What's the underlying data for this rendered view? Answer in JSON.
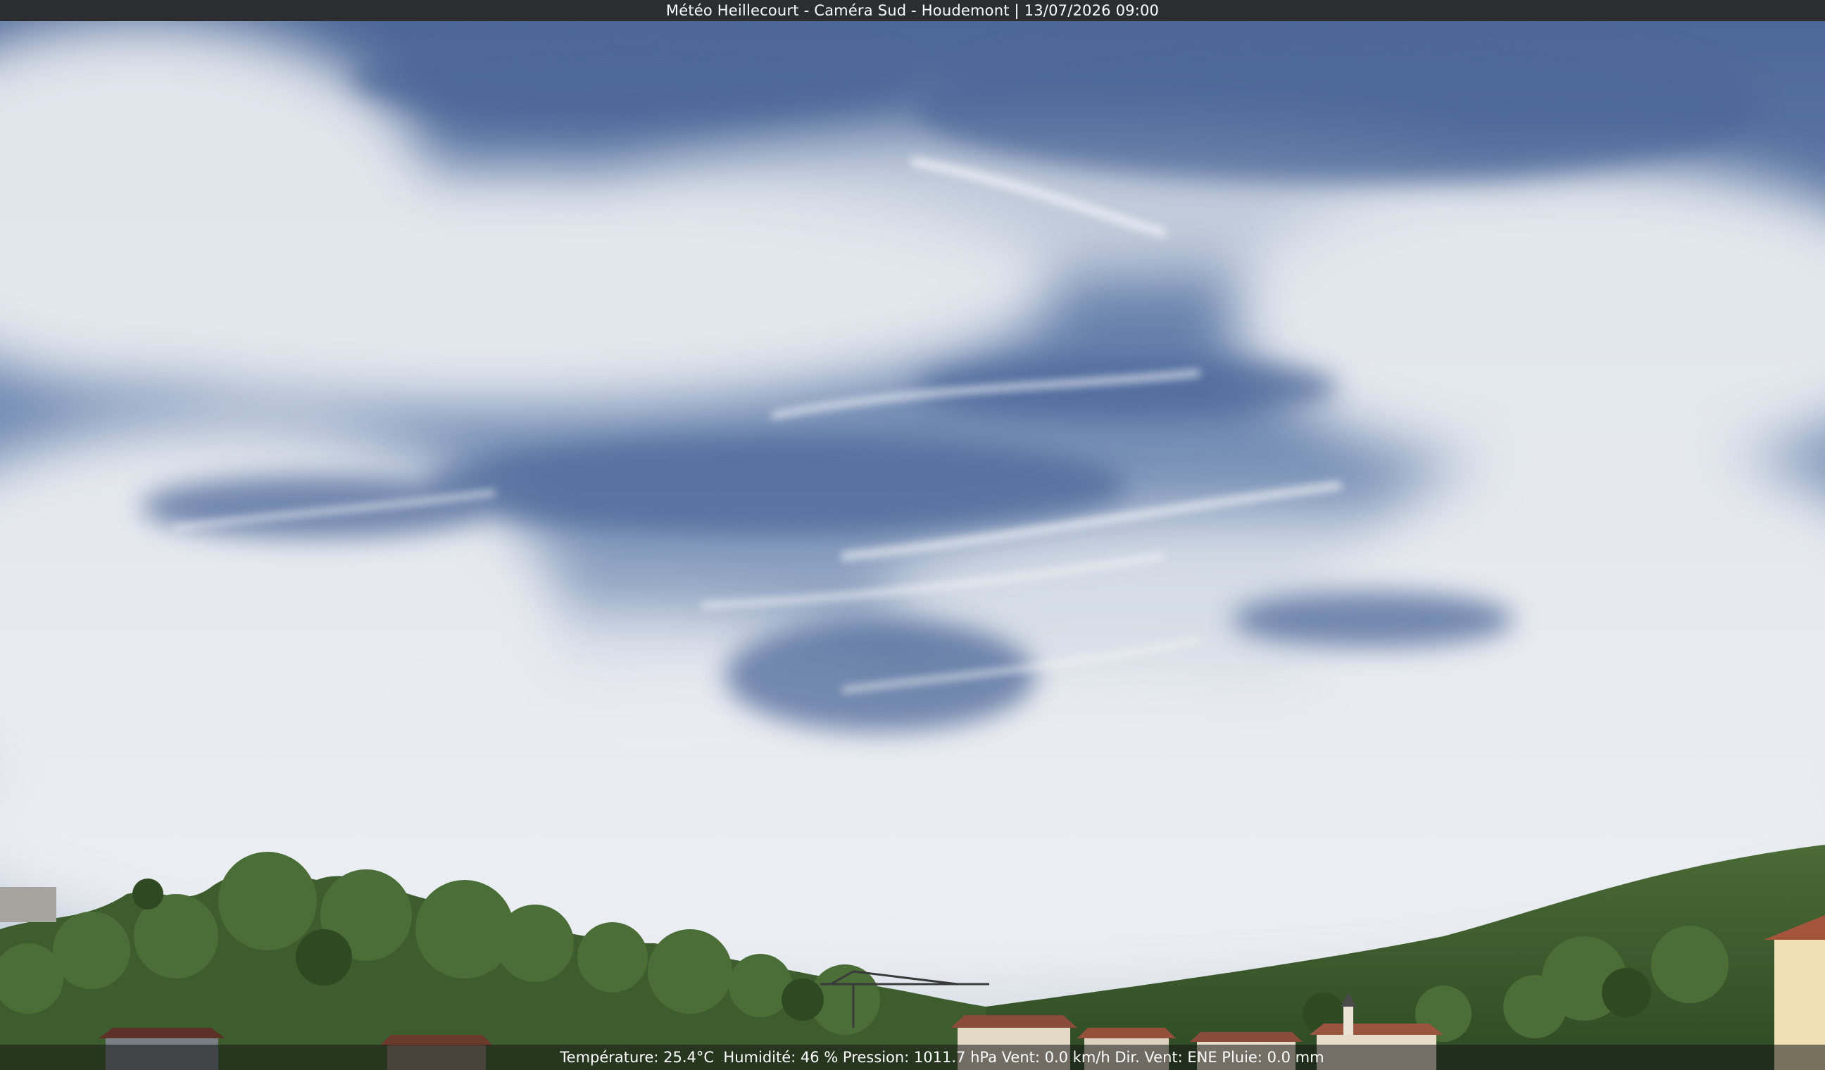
{
  "overlay": {
    "title": "Météo Heillecourt - Caméra Sud - Houdemont | 13/07/2026 09:00",
    "weather_line": "Température: 25.4°C  Humidité: 46 % Pression: 1011.7 hPa Vent: 0.0 km/h Dir. Vent: ENE Pluie: 0.0 mm"
  },
  "scene": {
    "sky_color": "#5f7aa8",
    "cloud_color": "#e9ecef",
    "vegetation_color": "#3c5a2c",
    "roof_color": "#8a4b38"
  }
}
